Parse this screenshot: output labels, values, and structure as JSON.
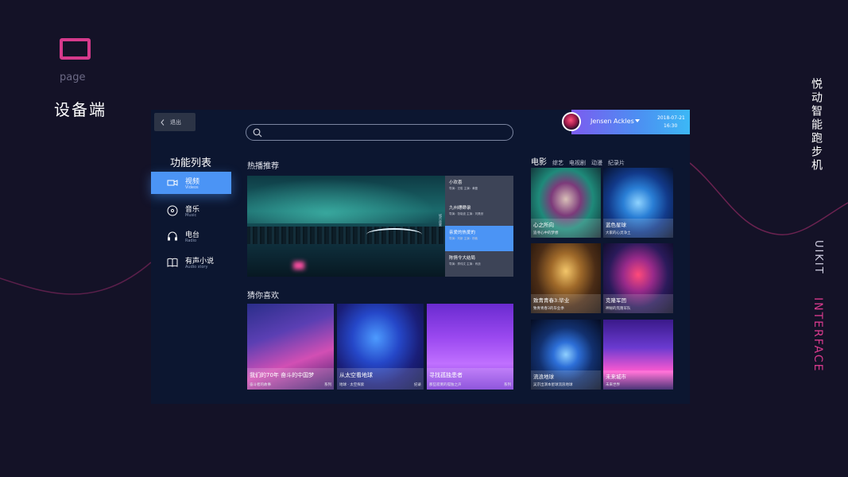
{
  "header": {
    "icon": "screen-frame-icon",
    "page_word": "page",
    "title": "设备端"
  },
  "side_labels": {
    "app_name": "悦动智能跑步机",
    "uikit": "UIKIT",
    "interface": "INTERFACE"
  },
  "colors": {
    "background": "#141227",
    "accent_pink": "#d63a8c",
    "accent_blue": "#4b94f5",
    "device_bg": "#0c1630"
  },
  "device": {
    "back": {
      "icon": "chevron-left-icon",
      "label": "退出"
    },
    "search": {
      "placeholder": "",
      "icon": "search-icon"
    },
    "user": {
      "name": "Jensen Ackles",
      "date": "2018-07-21",
      "time": "16:30"
    },
    "sidebar": {
      "title": "功能列表",
      "items": [
        {
          "label": "视频",
          "sub": "Videos",
          "icon": "video-camera-icon",
          "active": true
        },
        {
          "label": "音乐",
          "sub": "Music",
          "icon": "music-disc-icon",
          "active": false
        },
        {
          "label": "电台",
          "sub": "Radio",
          "icon": "headphones-icon",
          "active": false
        },
        {
          "label": "有声小说",
          "sub": "Audio story",
          "icon": "book-icon",
          "active": false
        }
      ]
    },
    "hot": {
      "title": "热播推荐",
      "hero_tag": "城市夜景",
      "playlist": [
        {
          "title": "小欢喜",
          "text": "导演：汪俊 主演：黄磊"
        },
        {
          "title": "九州缥缈录",
          "text": "导演：张晓波 主演：刘昊然"
        },
        {
          "title": "亲爱的热爱的",
          "text": "导演：刘新 主演：杨紫"
        },
        {
          "title": "陈情令大结局",
          "text": "导演：郑伟文 主演：肖战"
        }
      ]
    },
    "guess": {
      "title": "猜你喜欢",
      "items": [
        {
          "title": "我们的70年 奋斗的中国梦",
          "sub": "奋斗者的故事",
          "badge": "系列"
        },
        {
          "title": "从太空看地球",
          "sub": "地球 · 太空探索",
          "badge": "纪录"
        },
        {
          "title": "寻找孤独患者",
          "sub": "那些寂寞的孤独之声",
          "badge": "系列"
        }
      ]
    },
    "categories": {
      "tabs": [
        "电影",
        "综艺",
        "电视剧",
        "动漫",
        "纪录片"
      ],
      "movies": [
        {
          "title": "心之所向",
          "sub": "追寻心中的梦想"
        },
        {
          "title": "蓝色星球",
          "sub": "大家的心灵净土"
        },
        {
          "title": "致青青春3:毕业",
          "sub": "致青青春3的毕业季"
        },
        {
          "title": "克隆军团",
          "sub": "神秘的克隆军队"
        },
        {
          "title": "流浪地球",
          "sub": "吴京出演本星球流浪地球"
        },
        {
          "title": "未来城市",
          "sub": "未来世界"
        }
      ]
    }
  }
}
